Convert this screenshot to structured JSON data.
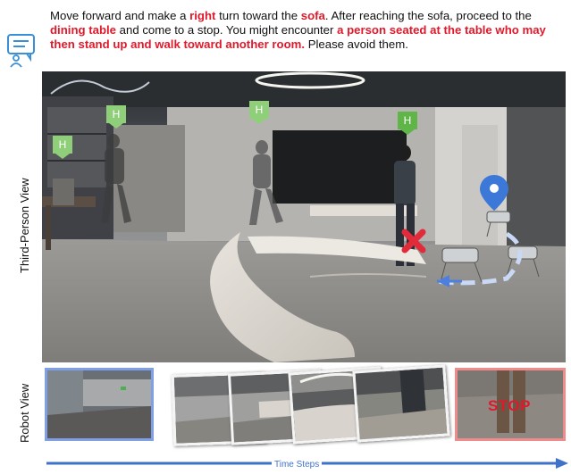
{
  "instruction": {
    "segments": [
      {
        "text": "Move forward and make a ",
        "highlight": false
      },
      {
        "text": "right",
        "highlight": true
      },
      {
        "text": " turn toward the ",
        "highlight": false
      },
      {
        "text": "sofa",
        "highlight": true
      },
      {
        "text": ". After reaching the sofa, proceed to the ",
        "highlight": false
      },
      {
        "text": "dining table",
        "highlight": true
      },
      {
        "text": " and come to a stop. You might encounter ",
        "highlight": false
      },
      {
        "text": "a person seated at the table who may then stand up and walk toward another room.",
        "highlight": true
      },
      {
        "text": " Please avoid them.",
        "highlight": false
      }
    ]
  },
  "icon_names": {
    "instruction": "chat-person-icon",
    "goal": "location-pin-icon",
    "collision": "red-x-icon"
  },
  "labels": {
    "third_person": "Third-Person View",
    "robot": "Robot View",
    "time_steps": "Time Steps"
  },
  "markers": [
    {
      "label": "H",
      "color": "#8fcf7a"
    },
    {
      "label": "H",
      "color": "#8fcf7a"
    },
    {
      "label": "H",
      "color": "#8fcf7a"
    },
    {
      "label": "H",
      "color": "#5fb548"
    }
  ],
  "stop": {
    "text": "STOP"
  },
  "colors": {
    "highlight": "#e0192b",
    "first_frame_border": "#7fa0e4",
    "last_frame_border": "#ef8b8b",
    "timeline": "#3f73c9",
    "pin": "#3c78d8"
  }
}
